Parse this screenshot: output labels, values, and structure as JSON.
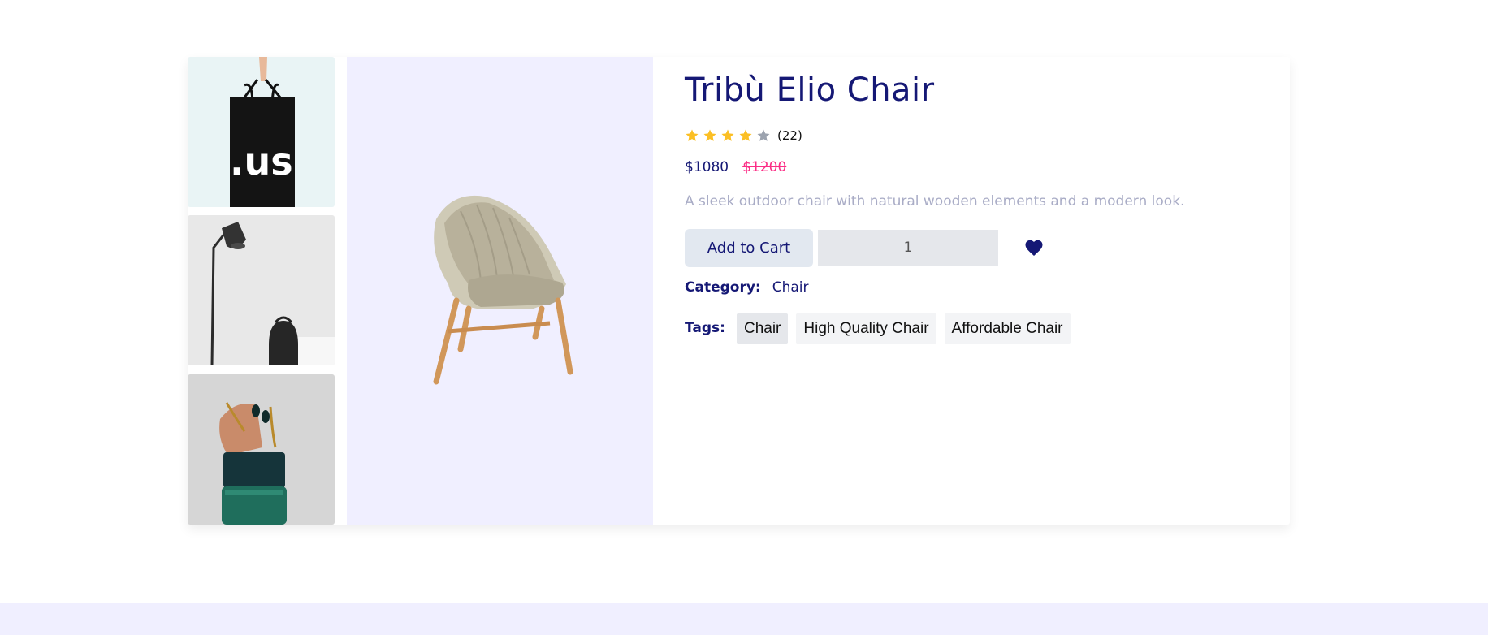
{
  "product": {
    "title": "Tribù Elio Chair",
    "rating": {
      "stars": 4,
      "max": 5,
      "count_text": "(22)"
    },
    "price_new": "$1080",
    "price_old": "$1200",
    "description": "A sleek outdoor chair with natural wooden elements and a modern look.",
    "add_to_cart_label": "Add to Cart",
    "quantity_value": "1",
    "category_label": "Category:",
    "category_value": "Chair",
    "tags_label": "Tags:",
    "tags": [
      "Chair",
      "High Quality Chair",
      "Affordable Chair"
    ],
    "thumbnail_text": ".us"
  },
  "colors": {
    "brand_navy": "#151875",
    "sale_pink": "#fb2e86",
    "star_gold": "#fbbf24",
    "star_empty": "#9ca3af",
    "panel_lavender": "#f0efff"
  },
  "icons": {
    "star": "star-icon",
    "heart": "heart-icon"
  }
}
